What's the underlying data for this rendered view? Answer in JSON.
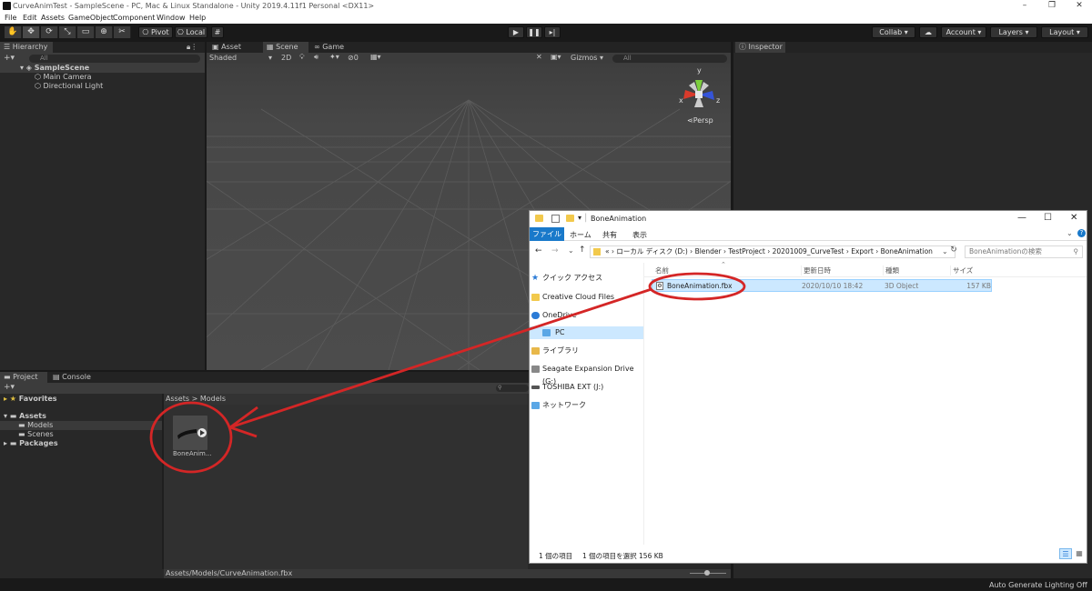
{
  "window": {
    "title": "CurveAnimTest - SampleScene - PC, Mac & Linux Standalone - Unity 2019.4.11f1 Personal <DX11>"
  },
  "menu": [
    "File",
    "Edit",
    "Assets",
    "GameObject",
    "Component",
    "Window",
    "Help"
  ],
  "toolbar": {
    "pivot": "Pivot",
    "local": "Local",
    "collab": "Collab ▾",
    "account": "Account",
    "layers": "Layers",
    "layout": "Layout"
  },
  "hierarchy": {
    "tab": "Hierarchy",
    "search_placeholder": "All",
    "scene": "SampleScene",
    "items": [
      "Main Camera",
      "Directional Light"
    ]
  },
  "sceneview": {
    "tabs": [
      "Asset Store",
      "Scene",
      "Game"
    ],
    "shading": "Shaded",
    "mode2d": "2D",
    "fx_count": "0",
    "gizmos": "Gizmos",
    "search_placeholder": "All",
    "persp": "Persp",
    "axes": {
      "x": "x",
      "y": "y",
      "z": "z"
    }
  },
  "inspector": {
    "tab": "Inspector"
  },
  "project": {
    "tabs": [
      "Project",
      "Console"
    ],
    "favorites": "Favorites",
    "assets": "Assets",
    "models": "Models",
    "scenes": "Scenes",
    "packages": "Packages",
    "breadcrumb": "Assets > Models",
    "asset_label": "BoneAnim...",
    "path": "Assets/Models/CurveAnimation.fbx"
  },
  "status": {
    "lighting": "Auto Generate Lighting Off"
  },
  "explorer": {
    "title": "BoneAnimation",
    "ribbon": [
      "ファイル",
      "ホーム",
      "共有",
      "表示"
    ],
    "path": [
      "ローカル ディスク (D:)",
      "Blender",
      "TestProject",
      "20201009_CurveTest",
      "Export",
      "BoneAnimation"
    ],
    "path_prefix": "«",
    "search_placeholder": "BoneAnimationの検索",
    "columns": [
      "名前",
      "更新日時",
      "種類",
      "サイズ"
    ],
    "file": {
      "name": "BoneAnimation.fbx",
      "date": "2020/10/10 18:42",
      "type": "3D Object",
      "size": "157 KB"
    },
    "nav": [
      "クイック アクセス",
      "Creative Cloud Files",
      "OneDrive",
      "PC",
      "ライブラリ",
      "Seagate Expansion Drive (G:)",
      "TOSHIBA EXT (J:)",
      "ネットワーク"
    ],
    "status_count": "1 個の項目",
    "status_selected": "1 個の項目を選択  156 KB"
  },
  "colors": {
    "annotation": "#d42626",
    "selection": "#cce8ff",
    "unity_dark": "#282828"
  }
}
